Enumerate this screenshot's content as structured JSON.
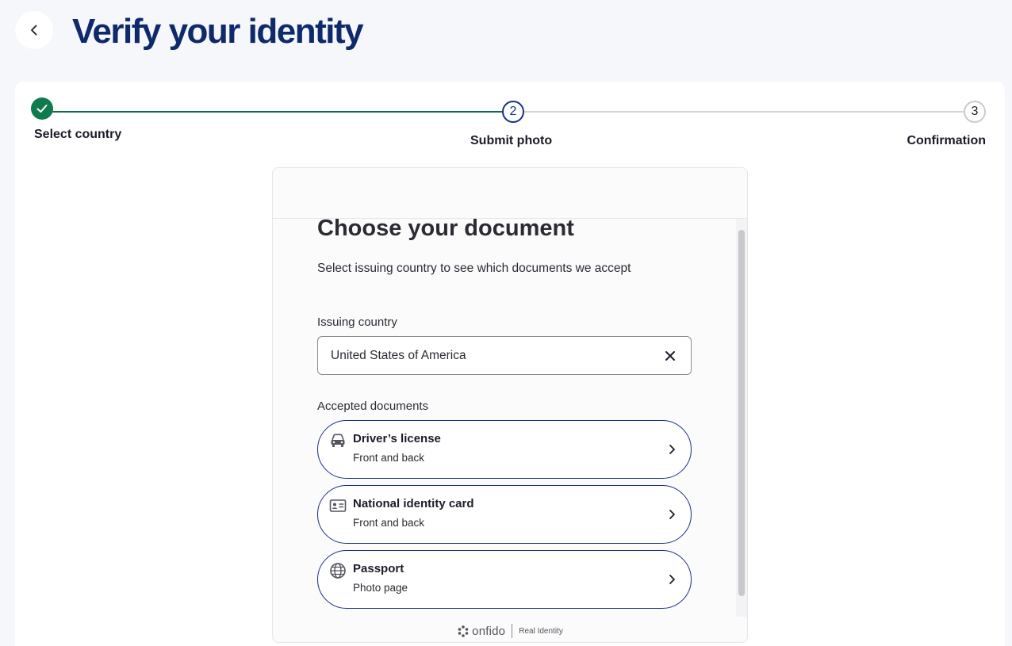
{
  "header": {
    "title": "Verify your identity"
  },
  "stepper": {
    "steps": [
      {
        "label": "Select country",
        "number": "1",
        "state": "done"
      },
      {
        "label": "Submit photo",
        "number": "2",
        "state": "current"
      },
      {
        "label": "Confirmation",
        "number": "3",
        "state": "upcoming"
      }
    ]
  },
  "document_picker": {
    "title": "Choose your document",
    "subtitle": "Select issuing country to see which documents we accept",
    "country_label": "Issuing country",
    "country_value": "United States of America",
    "accepted_label": "Accepted documents",
    "options": [
      {
        "title": "Driver’s license",
        "subtitle": "Front and back",
        "icon": "car-icon"
      },
      {
        "title": "National identity card",
        "subtitle": "Front and back",
        "icon": "id-card-icon"
      },
      {
        "title": "Passport",
        "subtitle": "Photo page",
        "icon": "globe-icon"
      }
    ]
  },
  "footer": {
    "brand": "onfido",
    "tagline": "Real Identity"
  },
  "colors": {
    "title": "#0e2a6b",
    "done": "#0e7a4e",
    "current": "#1a2f8a",
    "page_bg": "#f6f7fb"
  }
}
